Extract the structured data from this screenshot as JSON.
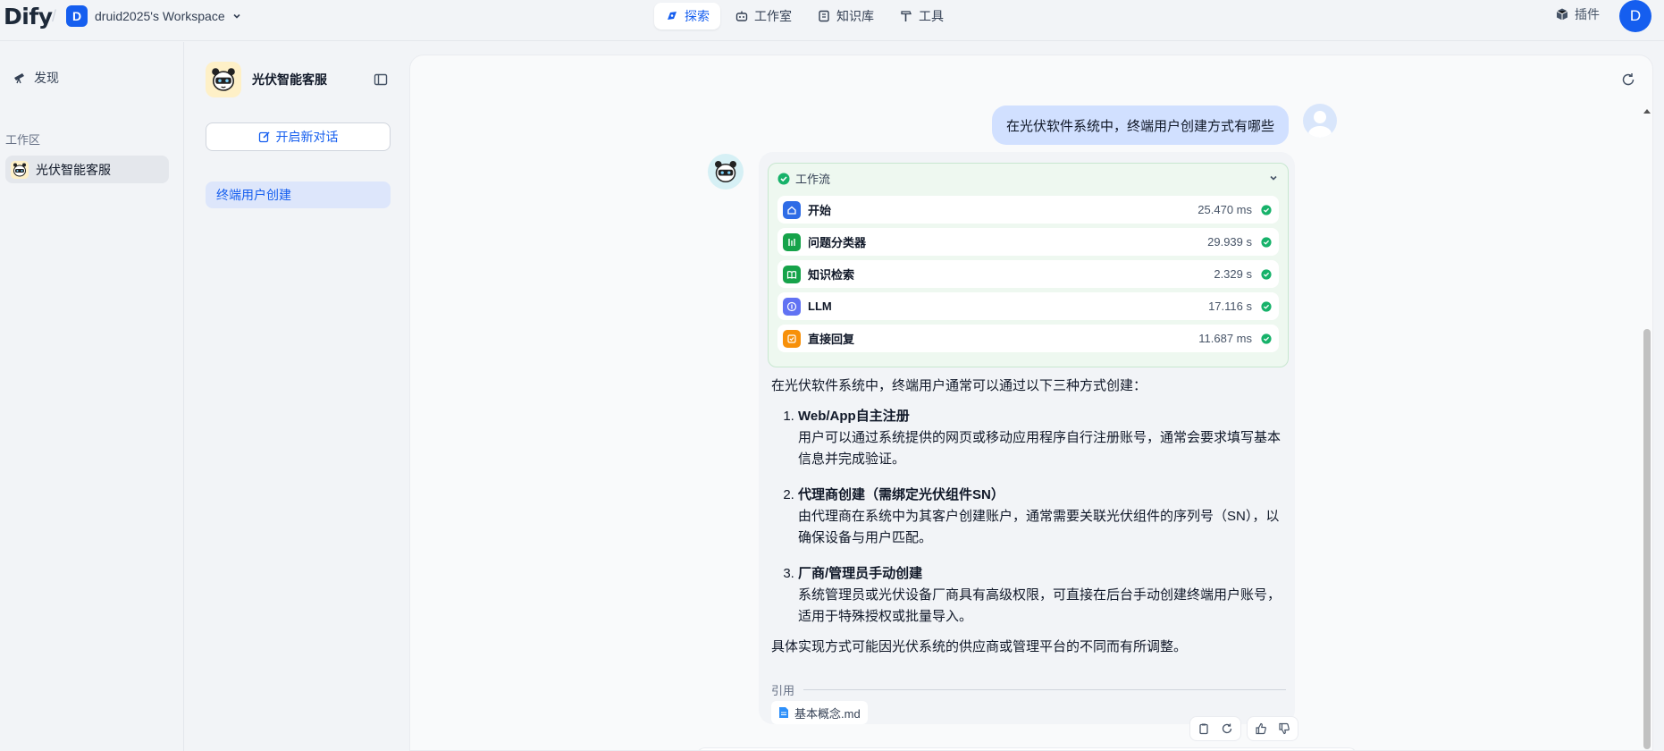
{
  "app": {
    "logo": "Dify",
    "workspace_initial": "D",
    "workspace_name": "druid2025's Workspace"
  },
  "nav": [
    {
      "label": "探索",
      "icon": "compass-icon",
      "active": true
    },
    {
      "label": "工作室",
      "icon": "robot-icon"
    },
    {
      "label": "知识库",
      "icon": "book-icon"
    },
    {
      "label": "工具",
      "icon": "hammer-icon"
    }
  ],
  "header_right": {
    "plugins_label": "插件",
    "avatar_initial": "D"
  },
  "sidebar": {
    "discover_label": "发现",
    "workspace_label": "工作区",
    "apps": [
      {
        "label": "光伏智能客服"
      }
    ]
  },
  "conversations": {
    "app_title": "光伏智能客服",
    "new_chat_label": "开启新对话",
    "items": [
      {
        "label": "终端用户创建"
      }
    ]
  },
  "chat": {
    "question": "在光伏软件系统中，终端用户创建方式有哪些",
    "workflow": {
      "title": "工作流",
      "nodes": [
        {
          "name": "开始",
          "time": "25.470 ms",
          "color": "#2e6ce6"
        },
        {
          "name": "问题分类器",
          "time": "29.939 s",
          "color": "#16a34a"
        },
        {
          "name": "知识检索",
          "time": "2.329 s",
          "color": "#16a34a"
        },
        {
          "name": "LLM",
          "time": "17.116 s",
          "color": "#6172f3"
        },
        {
          "name": "直接回复",
          "time": "11.687 ms",
          "color": "#f79009"
        }
      ]
    },
    "answer": {
      "lead": "在光伏软件系统中，终端用户通常可以通过以下三种方式创建：",
      "items": [
        {
          "title": "Web/App自主注册",
          "body": "用户可以通过系统提供的网页或移动应用程序自行注册账号，通常会要求填写基本信息并完成验证。"
        },
        {
          "title": "代理商创建（需绑定光伏组件SN）",
          "body": "由代理商在系统中为其客户创建账户，通常需要关联光伏组件的序列号（SN），以确保设备与用户匹配。"
        },
        {
          "title": "厂商/管理员手动创建",
          "body": "系统管理员或光伏设备厂商具有高级权限，可直接在后台手动创建终端用户账号，适用于特殊授权或批量导入。"
        }
      ],
      "tail": "具体实现方式可能因光伏系统的供应商或管理平台的不同而有所调整。"
    },
    "citation": {
      "label": "引用",
      "file": "基本概念.md"
    }
  }
}
